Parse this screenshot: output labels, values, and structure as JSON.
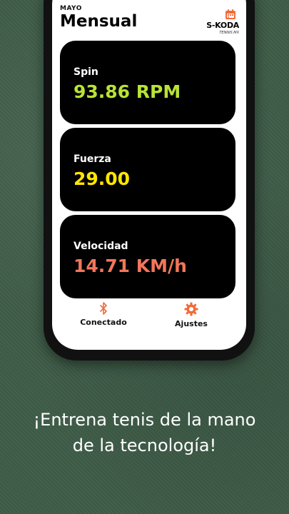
{
  "header": {
    "month": "MAYO",
    "title": "Mensual",
    "logo_text": "S-KODA",
    "logo_sub": "TENNIS.MX"
  },
  "cards": [
    {
      "label": "Spin",
      "value": "93.86 RPM",
      "color": "#b8e336"
    },
    {
      "label": "Fuerza",
      "value": "29.00",
      "color": "#ffe600"
    },
    {
      "label": "Velocidad",
      "value": "14.71 KM/h",
      "color": "#f2765a"
    }
  ],
  "nav": {
    "connected": {
      "label": "Conectado",
      "icon": "bluetooth-icon"
    },
    "settings": {
      "label": "Ajustes",
      "icon": "gear-icon"
    }
  },
  "accent_color": "#f26b3a",
  "tagline": {
    "line1": "¡Entrena tenis de la mano",
    "line2": "de la tecnología!"
  }
}
